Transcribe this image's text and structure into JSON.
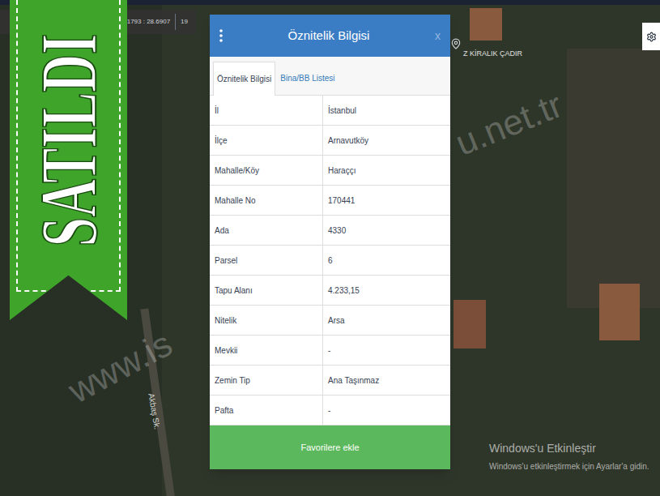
{
  "banner": {
    "text": "SATILDI"
  },
  "map": {
    "coordinates": "41.1793 : 28.6907",
    "zoom": "19",
    "labels": [
      {
        "text": "Akbaş Sk."
      },
      {
        "text": "Z KİRALIK ÇADIR"
      }
    ],
    "watermark": [
      "www.is",
      "u.net.tr"
    ]
  },
  "dialog": {
    "title": "Öznitelik Bilgisi",
    "close": "x",
    "tabs": [
      {
        "label": "Öznitelik Bilgisi",
        "selected": true
      },
      {
        "label": "Bina/BB Listesi",
        "selected": false
      }
    ],
    "rows": [
      {
        "label": "İl",
        "value": "İstanbul"
      },
      {
        "label": "İlçe",
        "value": "Arnavutköy"
      },
      {
        "label": "Mahalle/Köy",
        "value": "Haraççı"
      },
      {
        "label": "Mahalle No",
        "value": "170441"
      },
      {
        "label": "Ada",
        "value": "4330"
      },
      {
        "label": "Parsel",
        "value": "6"
      },
      {
        "label": "Tapu Alanı",
        "value": "4.233,15"
      },
      {
        "label": "Nitelik",
        "value": "Arsa"
      },
      {
        "label": "Mevkii",
        "value": "-"
      },
      {
        "label": "Zemin Tip",
        "value": "Ana Taşınmaz"
      },
      {
        "label": "Pafta",
        "value": "-"
      }
    ],
    "button": "Favorilere ekle"
  },
  "os_notice": {
    "title": "Windows'u Etkinleştir",
    "text": "Windows'u etkinleştirmek için Ayarlar'a gidin."
  }
}
